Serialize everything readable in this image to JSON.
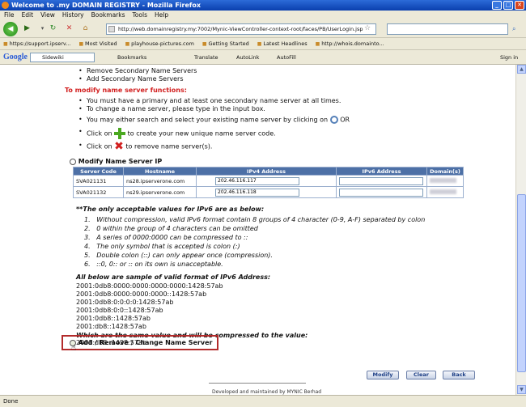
{
  "window": {
    "title": "Welcome to .my DOMAIN REGISTRY - Mozilla Firefox"
  },
  "menu": [
    "File",
    "Edit",
    "View",
    "History",
    "Bookmarks",
    "Tools",
    "Help"
  ],
  "nav": {
    "url": "http://web.domainregistry.my:7002/Mynic-ViewController-context-root/faces/PB/UserLogin.jsp"
  },
  "bookmarks": [
    "https://support.ipserv...",
    "Most Visited",
    "playhouse-pictures.com",
    "Getting Started",
    "Latest Headlines",
    "http://whois.domainto..."
  ],
  "google_bar": {
    "logo": "Google",
    "items": [
      "Sidewiki",
      "Bookmarks",
      "Translate",
      "AutoLink",
      "AutoFill"
    ],
    "signin": "Sign in"
  },
  "page": {
    "top_bullets": [
      "Remove Secondary Name Servers",
      "Add Secondary Name Servers"
    ],
    "modify_heading": "To modify name server functions:",
    "rules": [
      "You must have a primary and at least one secondary name server at all times.",
      "To change a name server, please type in the input box."
    ],
    "search_rule": "You may either search and select your existing name server by clicking on",
    "search_rule_or": "OR",
    "click_on": "Click on",
    "create_rule": "to create your new unique name server code.",
    "remove_rule": "to remove name server(s).",
    "modify_ip_label": "Modify Name Server IP",
    "table": {
      "headers": [
        "Server Code",
        "Hostname",
        "IPv4 Address",
        "IPv6 Address",
        "Domain(s)"
      ],
      "rows": [
        {
          "code": "SVA021131",
          "host": "ns28.ipserverone.com",
          "ipv4": "202.46.116.117",
          "ipv6": ""
        },
        {
          "code": "SVA021132",
          "host": "ns29.ipserverone.com",
          "ipv4": "202.46.116.118",
          "ipv6": ""
        }
      ]
    },
    "ipv6_heading": "**The only acceptable values for IPv6 are as below:",
    "ipv6_rules": [
      "Without compression, valid IPv6 format contain 8 groups of 4 character (0-9, A-F) separated by colon",
      "0 within the group of 4 characters can be omitted",
      "A series of 0000:0000 can be compressed to ::",
      "The only symbol that is accepted is colon (:)",
      "Double colon (::) can only appear once (compression).",
      "::0, 0:: or :: on its own is unacceptable."
    ],
    "sample_heading": "All below are sample of valid format of IPv6 Address:",
    "samples": [
      "2001:0db8:0000:0000:0000:0000:1428:57ab",
      "2001:0db8:0000:0000:0000::1428:57ab",
      "2001:0db8:0:0:0:0:1428:57ab",
      "2001:0db8:0:0::1428:57ab",
      "2001:0db8::1428:57ab",
      "2001:db8::1428:57ab"
    ],
    "compressed_heading": "Which are the same value and will be compressed to the value:",
    "compressed_value": "2001:db8::1428:57ab",
    "add_remove_label": "Add / Remove / Change Name Server",
    "buttons": {
      "modify": "Modify",
      "clear": "Clear",
      "back": "Back"
    },
    "footer": "Developed and maintained by MYNIC Berhad"
  },
  "status": "Done"
}
